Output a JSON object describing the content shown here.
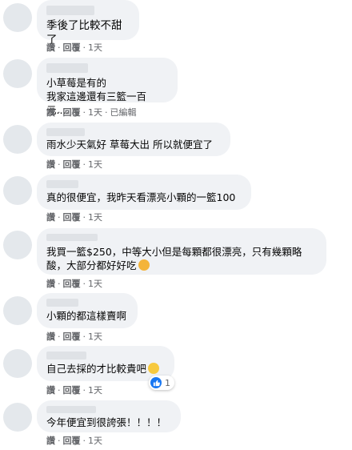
{
  "actions": {
    "like": "讚",
    "reply": "回覆",
    "dot": "·",
    "edited": "已編輯"
  },
  "comments": [
    {
      "text": "季後了比較不甜了",
      "time": "1天"
    },
    {
      "text": "小草莓是有的\n我家這邊還有三籃一百元....",
      "time": "1天"
    },
    {
      "text": "雨水少天氣好 草莓大出 所以就便宜了",
      "time": "1天"
    },
    {
      "text": "真的很便宜，我昨天看漂亮小顆的一籃100",
      "time": "1天"
    },
    {
      "text": "我買一籃$250，中等大小但是每顆都很漂亮，只有幾顆略\n酸，大部分都好好吃",
      "time": "1天"
    },
    {
      "text": "小顆的都這樣賣啊",
      "time": "1天"
    },
    {
      "text": "自己去採的才比較貴吧",
      "time": "1天",
      "reaction_count": "1"
    },
    {
      "text": "今年便宜到很誇張！！！！",
      "time": "1天"
    }
  ],
  "colors": {
    "bubble": "#f0f2f5",
    "meta": "#65676b",
    "like": "#1877f2"
  },
  "icons": {
    "reaction": "like-icon",
    "emoji_love": "smiling-face-with-hearts-emoji",
    "emoji_grin": "grinning-face-emoji"
  }
}
